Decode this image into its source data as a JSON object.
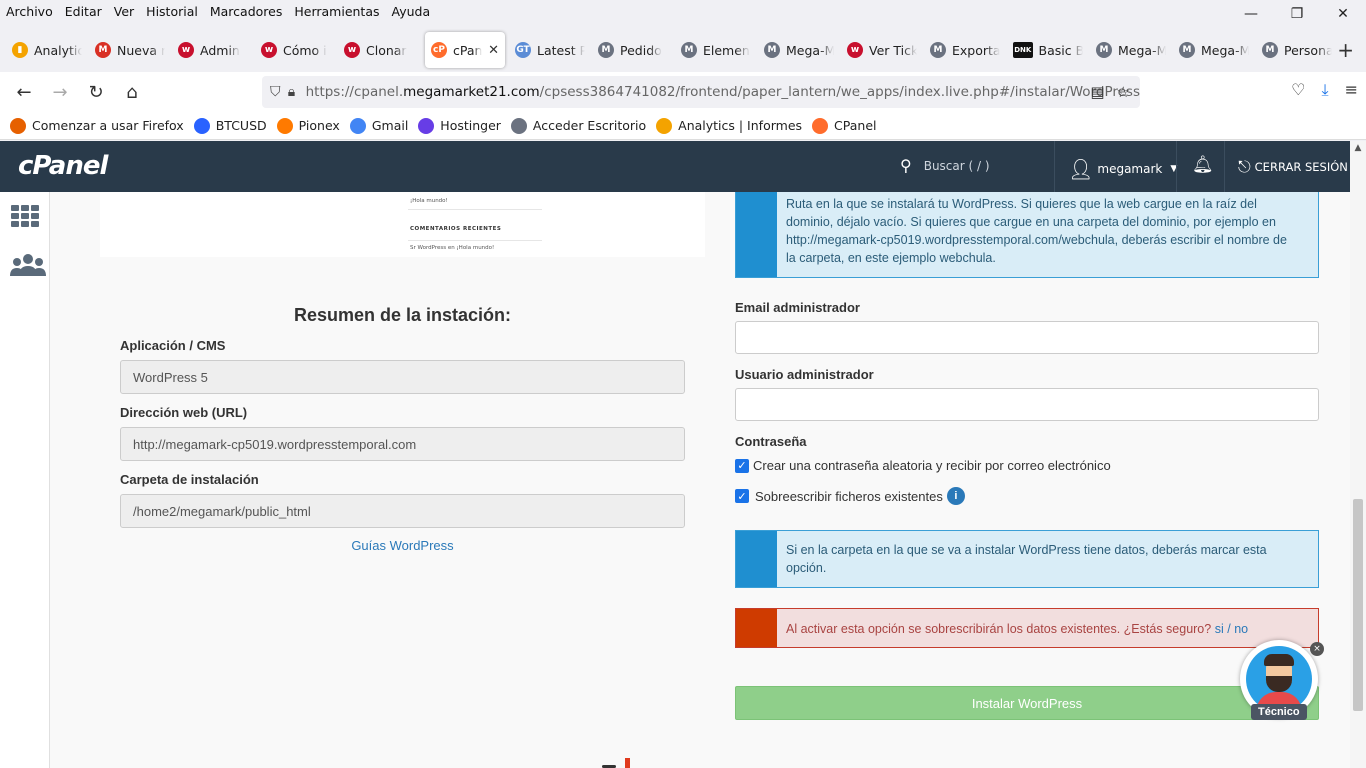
{
  "menu": [
    "Archivo",
    "Editar",
    "Ver",
    "Historial",
    "Marcadores",
    "Herramientas",
    "Ayuda"
  ],
  "window_controls": {
    "minimize": "—",
    "restore": "❐",
    "close": "✕"
  },
  "tabs": [
    {
      "label": "Analytic",
      "icon": "analytics-icon",
      "color": "#f4a300",
      "glyph": "▮"
    },
    {
      "label": "Nueva r",
      "icon": "gmail-icon",
      "color": "#d93025",
      "glyph": "M"
    },
    {
      "label": "Admin",
      "icon": "webnode-icon",
      "color": "#c8102e",
      "glyph": "w"
    },
    {
      "label": "Cómo i",
      "icon": "webnode-icon",
      "color": "#c8102e",
      "glyph": "w"
    },
    {
      "label": "Clonar",
      "icon": "webnode-icon",
      "color": "#c8102e",
      "glyph": "w"
    },
    {
      "label": "cPan",
      "icon": "cpanel-icon",
      "color": "#ff6c2c",
      "glyph": "cP",
      "active": true
    },
    {
      "label": "Latest P",
      "icon": "gt-icon",
      "color": "#5b8cd6",
      "glyph": "GT"
    },
    {
      "label": "Pedido",
      "icon": "megamarket-icon",
      "color": "#6b7280",
      "glyph": "M"
    },
    {
      "label": "Elemen",
      "icon": "megamarket-icon",
      "color": "#6b7280",
      "glyph": "M"
    },
    {
      "label": "Mega-M",
      "icon": "megamarket-icon",
      "color": "#6b7280",
      "glyph": "M"
    },
    {
      "label": "Ver Tick",
      "icon": "ticket-icon",
      "color": "#c8102e",
      "glyph": "w"
    },
    {
      "label": "Exporta",
      "icon": "megamarket-icon",
      "color": "#6b7280",
      "glyph": "M"
    },
    {
      "label": "Basic B",
      "icon": "dnk-icon",
      "color": "#111111",
      "glyph": "DNK"
    },
    {
      "label": "Mega-M",
      "icon": "megamarket-icon",
      "color": "#6b7280",
      "glyph": "M"
    },
    {
      "label": "Mega-M",
      "icon": "megamarket-icon",
      "color": "#6b7280",
      "glyph": "M"
    },
    {
      "label": "Persona",
      "icon": "megamarket-icon",
      "color": "#6b7280",
      "glyph": "M"
    }
  ],
  "new_tab": "+",
  "url": {
    "prefix": "https://cpanel.",
    "host": "megamarket21.com",
    "path": "/cpsess3864741082/frontend/paper_lantern/we_apps/index.live.php#/instalar/WordPress"
  },
  "bookmarks": [
    {
      "label": "Comenzar a usar Firefox",
      "icon": "firefox-icon",
      "color": "#e66000"
    },
    {
      "label": "BTCUSD",
      "icon": "tradingview-icon",
      "color": "#2962ff"
    },
    {
      "label": "Pionex",
      "icon": "pionex-icon",
      "color": "#ff7a00"
    },
    {
      "label": "Gmail",
      "icon": "google-icon",
      "color": "#4285f4"
    },
    {
      "label": "Hostinger",
      "icon": "hostinger-icon",
      "color": "#673de6"
    },
    {
      "label": "Acceder Escritorio",
      "icon": "megamarket-icon",
      "color": "#6b7280"
    },
    {
      "label": "Analytics | Informes",
      "icon": "analytics-icon",
      "color": "#f4a300"
    },
    {
      "label": "CPanel",
      "icon": "cpanel-icon",
      "color": "#ff6c2c"
    }
  ],
  "cpanel": {
    "logo": "cPanel",
    "search_placeholder": "Buscar ( / )",
    "user": "megamark",
    "logout": "CERRAR SESIÓN"
  },
  "preview": {
    "post": "¡Hola mundo!",
    "heading": "COMENTARIOS RECIENTES",
    "comment": "Sr WordPress en ¡Hola mundo!"
  },
  "summary": {
    "title": "Resumen de la instación:",
    "app_label": "Aplicación / CMS",
    "app_value": "WordPress 5",
    "url_label": "Dirección web (URL)",
    "url_value": "http://megamark-cp5019.wordpresstemporal.com",
    "folder_label": "Carpeta de instalación",
    "folder_value": "/home2/megamark/public_html",
    "guides_link": "Guías WordPress"
  },
  "form": {
    "path_info": "Ruta en la que se instalará tu WordPress. Si quieres que la web cargue en la raíz del dominio, déjalo vacío. Si quieres que cargue en una carpeta del dominio, por ejemplo en http://megamark-cp5019.wordpresstemporal.com/webchula, deberás escribir el nombre de la carpeta, en este ejemplo webchula.",
    "email_label": "Email administrador",
    "email_value": "",
    "user_label": "Usuario administrador",
    "user_value": "",
    "password_label": "Contraseña",
    "password_checkbox": "Crear una contraseña aleatoria y recibir por correo electrónico",
    "overwrite_checkbox": "Sobreescribir ficheros existentes",
    "overwrite_info": "Si en la carpeta en la que se va a instalar WordPress tiene datos, deberás marcar esta opción.",
    "danger_text": "Al activar esta opción se sobrescribirán los datos existentes. ¿Estás seguro?",
    "danger_yes": "si",
    "danger_sep": "/",
    "danger_no": "no",
    "install_button": "Instalar WordPress"
  },
  "chat_widget": {
    "label": "Técnico",
    "close": "×"
  },
  "colors": {
    "cpanel_header": "#293a4a",
    "info_bar": "#1f8fd0",
    "danger_bar": "#cf3b00",
    "install_button": "#8fcf8a",
    "link": "#2a79b9"
  }
}
